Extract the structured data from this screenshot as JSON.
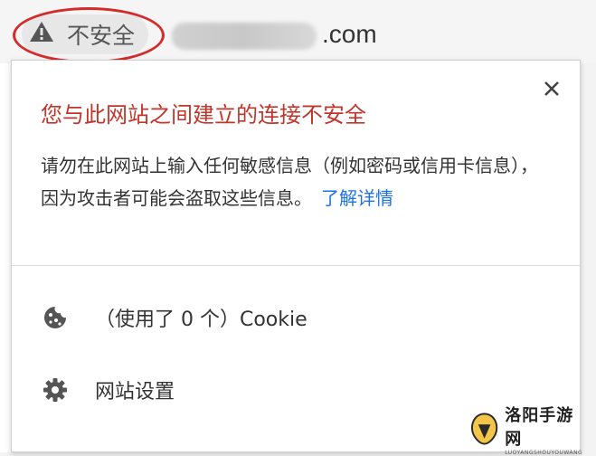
{
  "address_bar": {
    "security_label": "不安全",
    "url_suffix": ".com"
  },
  "popup": {
    "title": "您与此网站之间建立的连接不安全",
    "description": "请勿在此网站上输入任何敏感信息（例如密码或信用卡信息），因为攻击者可能会盗取这些信息。",
    "learn_more": "了解详情",
    "cookies_label": "（使用了 0 个）Cookie",
    "site_settings_label": "网站设置"
  },
  "watermark": {
    "name": "洛阳手游网",
    "sub": "LUOYANGSHOUYOUWANG"
  },
  "colors": {
    "title_red": "#c2352b",
    "link_blue": "#1a73e8",
    "annotation_red": "#d52a2a"
  }
}
